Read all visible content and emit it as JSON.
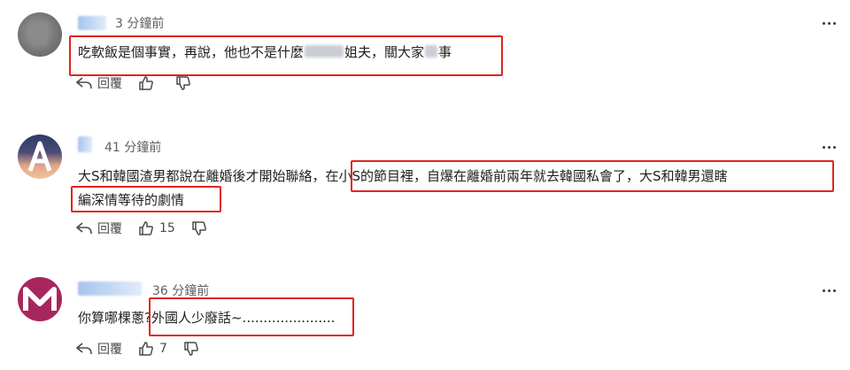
{
  "colors": {
    "highlight": "#e0251f",
    "text": "#1f1f1f",
    "meta": "#606060"
  },
  "comments": [
    {
      "time": "3 分鐘前",
      "line1": "吃軟飯是個事實，再說，他也不是什麼",
      "line1_b": "姐夫，關大家",
      "line1_c": "事",
      "reply_label": "回覆",
      "likes": ""
    },
    {
      "time": "41 分鐘前",
      "line1_a": "大S和韓國渣男都說在離婚後才開始聯絡，",
      "line1_b": "在小S的節目裡，自爆在離婚前兩年就去韓國私會了，大S和韓男還瞎",
      "line2": "編深情等待的劇情",
      "reply_label": "回覆",
      "likes": "15"
    },
    {
      "time": "36 分鐘前",
      "line1_a": "你算哪棵蔥",
      "line1_b": "?外國人少廢話~......................",
      "reply_label": "回覆",
      "likes": "7"
    }
  ]
}
